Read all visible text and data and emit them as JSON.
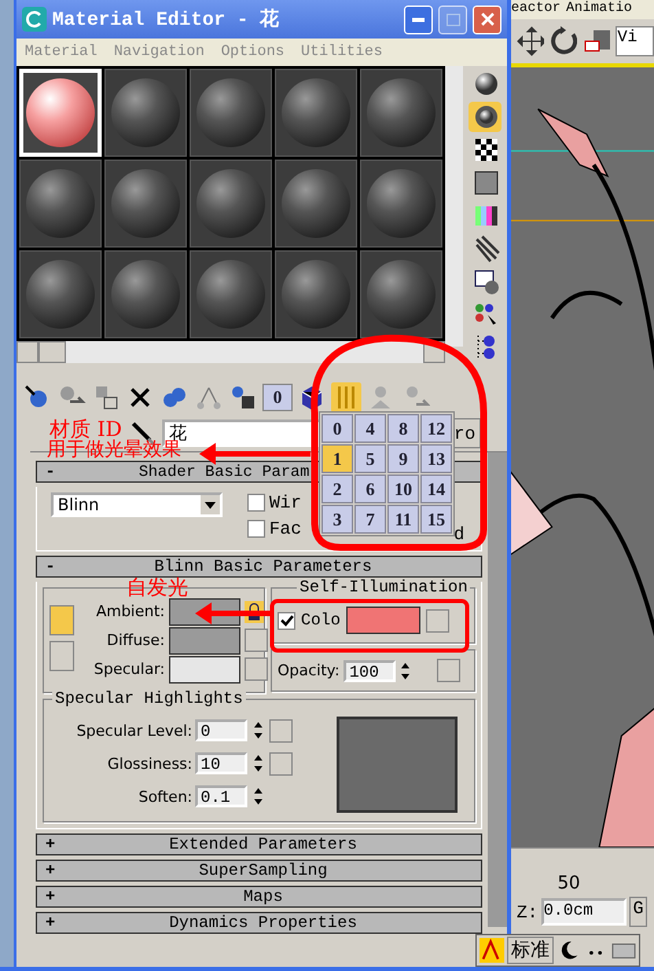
{
  "app_menu": [
    "eactor",
    "Animatio"
  ],
  "app_toolbar": {
    "field": "Vi"
  },
  "window": {
    "title": "Material Editor - 花"
  },
  "menu": [
    "Material",
    "Navigation",
    "Options",
    "Utilities"
  ],
  "sample_slots": [
    {
      "selected": true
    },
    {
      "selected": false
    },
    {
      "selected": false
    },
    {
      "selected": false
    },
    {
      "selected": false
    },
    {
      "selected": false
    },
    {
      "selected": false
    },
    {
      "selected": false
    },
    {
      "selected": false
    },
    {
      "selected": false
    },
    {
      "selected": false
    },
    {
      "selected": false
    },
    {
      "selected": false
    },
    {
      "selected": false
    },
    {
      "selected": false
    }
  ],
  "side_toolbar": [
    {
      "kind": "sample-type",
      "selected": false
    },
    {
      "kind": "backlight",
      "selected": true
    },
    {
      "kind": "checker",
      "selected": false
    },
    {
      "kind": "background",
      "selected": false
    },
    {
      "kind": "color-bars",
      "selected": false
    },
    {
      "kind": "film",
      "selected": false
    },
    {
      "kind": "options",
      "selected": false
    },
    {
      "kind": "select-by",
      "selected": false
    },
    {
      "kind": "navigator",
      "selected": false
    }
  ],
  "bottom_toolbar": [
    {
      "kind": "get",
      "selected": false
    },
    {
      "kind": "put",
      "selected": false
    },
    {
      "kind": "assign",
      "selected": false
    },
    {
      "kind": "delete",
      "selected": false
    },
    {
      "kind": "copy",
      "selected": false
    },
    {
      "kind": "unique",
      "selected": false
    },
    {
      "kind": "library",
      "selected": false
    },
    {
      "kind": "material-id",
      "selected": false
    },
    {
      "kind": "cube",
      "selected": false
    },
    {
      "kind": "end-result",
      "selected": true
    },
    {
      "kind": "parent",
      "selected": false
    },
    {
      "kind": "sibling",
      "selected": false
    }
  ],
  "material_id": {
    "button": "0",
    "options": [
      {
        "label": "0",
        "selected": false
      },
      {
        "label": "1",
        "selected": true
      },
      {
        "label": "2",
        "selected": false
      },
      {
        "label": "3",
        "selected": false
      },
      {
        "label": "4",
        "selected": false
      },
      {
        "label": "5",
        "selected": false
      },
      {
        "label": "6",
        "selected": false
      },
      {
        "label": "7",
        "selected": false
      },
      {
        "label": "8",
        "selected": false
      },
      {
        "label": "9",
        "selected": false
      },
      {
        "label": "10",
        "selected": false
      },
      {
        "label": "11",
        "selected": false
      },
      {
        "label": "12",
        "selected": false
      },
      {
        "label": "13",
        "selected": false
      },
      {
        "label": "14",
        "selected": false
      },
      {
        "label": "15",
        "selected": false
      }
    ]
  },
  "material_name": "花",
  "type_button": "ro",
  "shader_rollout": {
    "toggle": "-",
    "title": "Shader Basic Param",
    "shader": "Blinn",
    "options": [
      {
        "label": "Wir",
        "checked": false
      },
      {
        "label": "Fac",
        "checked": false
      }
    ],
    "fragment": "d"
  },
  "blinn_rollout": {
    "toggle": "-",
    "title": "Blinn Basic Parameters",
    "colors": [
      {
        "label": "Ambient:",
        "color": "#9a9a9a"
      },
      {
        "label": "Diffuse:",
        "color": "#9a9a9a"
      },
      {
        "label": "Specular:",
        "color": "#e6e6e6"
      }
    ],
    "self_illumination": {
      "title": "Self-Illumination",
      "checked": true,
      "label": "Colo",
      "color": "#f07474"
    },
    "opacity": {
      "label": "Opacity:",
      "value": "100"
    },
    "highlights": {
      "title": "Specular Highlights",
      "fields": [
        {
          "label": "Specular Level:",
          "value": "0"
        },
        {
          "label": "Glossiness:",
          "value": "10"
        },
        {
          "label": "Soften:",
          "value": "0.1"
        }
      ]
    }
  },
  "rollouts": [
    {
      "toggle": "+",
      "title": "Extended Parameters"
    },
    {
      "toggle": "+",
      "title": "SuperSampling"
    },
    {
      "toggle": "+",
      "title": "Maps"
    },
    {
      "toggle": "+",
      "title": "Dynamics Properties"
    }
  ],
  "annotations": {
    "material_id": "材质 ID",
    "glow": "用于做光晕效果",
    "self_illum": "自发光"
  },
  "timeline": {
    "tick": "50"
  },
  "coords": {
    "label": "Z:",
    "value": "0.0cm",
    "next": "G"
  },
  "ime": {
    "label": "标准"
  }
}
